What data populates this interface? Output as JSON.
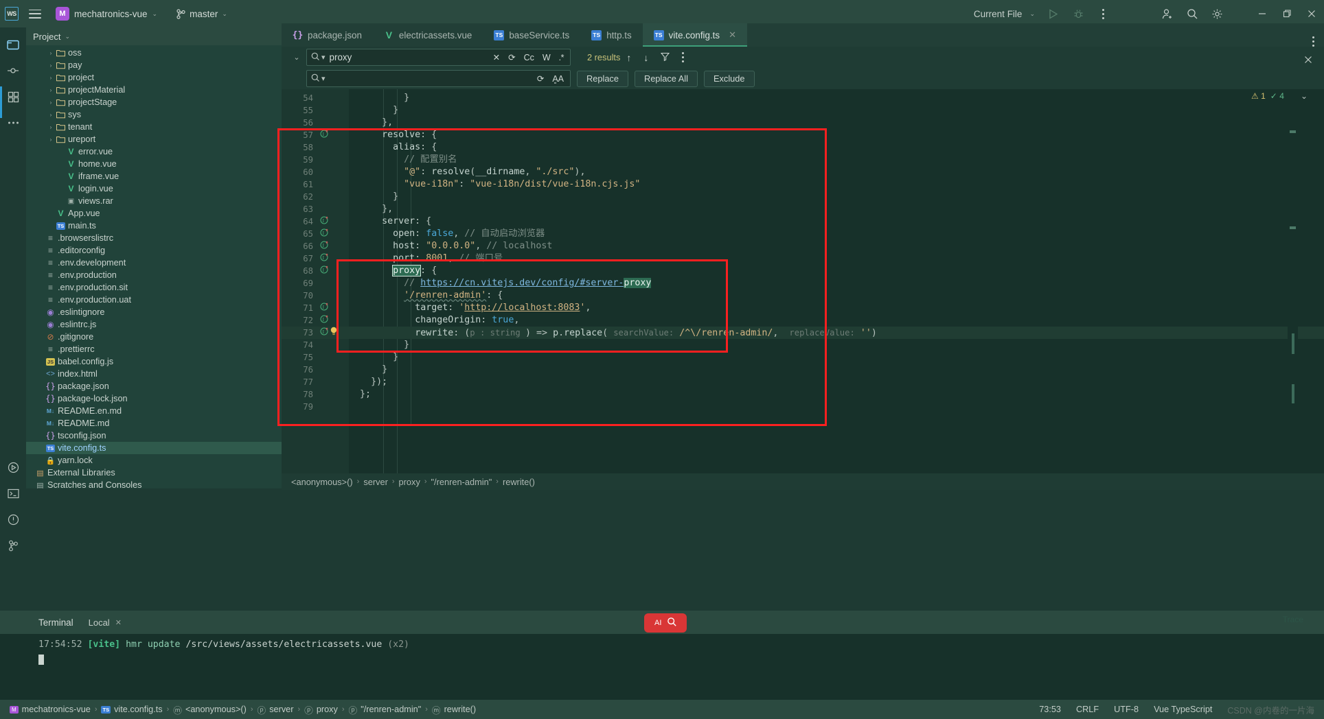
{
  "topbar": {
    "logo": "WS",
    "menu_icon": "hamburger-icon",
    "project_badge": "M",
    "project_name": "mechatronics-vue",
    "branch": "master",
    "run_config": "Current File",
    "icons": [
      "run-icon",
      "debug-icon",
      "more-vertical-icon",
      "add-user-icon",
      "search-icon",
      "settings-icon",
      "minimize-icon",
      "maximize-icon",
      "close-icon"
    ]
  },
  "project_pane": {
    "title": "Project",
    "tree": [
      {
        "indent": 2,
        "arrow": "›",
        "icon": "folder",
        "label": "oss"
      },
      {
        "indent": 2,
        "arrow": "›",
        "icon": "folder",
        "label": "pay"
      },
      {
        "indent": 2,
        "arrow": "›",
        "icon": "folder",
        "label": "project"
      },
      {
        "indent": 2,
        "arrow": "›",
        "icon": "folder",
        "label": "projectMaterial"
      },
      {
        "indent": 2,
        "arrow": "›",
        "icon": "folder",
        "label": "projectStage"
      },
      {
        "indent": 2,
        "arrow": "›",
        "icon": "folder",
        "label": "sys"
      },
      {
        "indent": 2,
        "arrow": "›",
        "icon": "folder",
        "label": "tenant"
      },
      {
        "indent": 2,
        "arrow": "›",
        "icon": "folder",
        "label": "ureport"
      },
      {
        "indent": 3,
        "arrow": "",
        "icon": "vue",
        "label": "error.vue"
      },
      {
        "indent": 3,
        "arrow": "",
        "icon": "vue",
        "label": "home.vue"
      },
      {
        "indent": 3,
        "arrow": "",
        "icon": "vue",
        "label": "iframe.vue"
      },
      {
        "indent": 3,
        "arrow": "",
        "icon": "vue",
        "label": "login.vue"
      },
      {
        "indent": 3,
        "arrow": "",
        "icon": "rar",
        "label": "views.rar"
      },
      {
        "indent": 2,
        "arrow": "",
        "icon": "vue",
        "label": "App.vue"
      },
      {
        "indent": 2,
        "arrow": "",
        "icon": "ts",
        "label": "main.ts"
      },
      {
        "indent": 1,
        "arrow": "",
        "icon": "cfg",
        "label": ".browserslistrc"
      },
      {
        "indent": 1,
        "arrow": "",
        "icon": "cfg",
        "label": ".editorconfig"
      },
      {
        "indent": 1,
        "arrow": "",
        "icon": "cfg",
        "label": ".env.development"
      },
      {
        "indent": 1,
        "arrow": "",
        "icon": "cfg",
        "label": ".env.production"
      },
      {
        "indent": 1,
        "arrow": "",
        "icon": "cfg",
        "label": ".env.production.sit"
      },
      {
        "indent": 1,
        "arrow": "",
        "icon": "cfg",
        "label": ".env.production.uat"
      },
      {
        "indent": 1,
        "arrow": "",
        "icon": "eslint",
        "label": ".eslintignore"
      },
      {
        "indent": 1,
        "arrow": "",
        "icon": "eslint",
        "label": ".eslintrc.js"
      },
      {
        "indent": 1,
        "arrow": "",
        "icon": "git",
        "label": ".gitignore"
      },
      {
        "indent": 1,
        "arrow": "",
        "icon": "cfg",
        "label": ".prettierrc"
      },
      {
        "indent": 1,
        "arrow": "",
        "icon": "js",
        "label": "babel.config.js"
      },
      {
        "indent": 1,
        "arrow": "",
        "icon": "html",
        "label": "index.html"
      },
      {
        "indent": 1,
        "arrow": "",
        "icon": "json",
        "label": "package.json"
      },
      {
        "indent": 1,
        "arrow": "",
        "icon": "json",
        "label": "package-lock.json"
      },
      {
        "indent": 1,
        "arrow": "",
        "icon": "md",
        "label": "README.en.md"
      },
      {
        "indent": 1,
        "arrow": "",
        "icon": "md",
        "label": "README.md"
      },
      {
        "indent": 1,
        "arrow": "",
        "icon": "json",
        "label": "tsconfig.json"
      },
      {
        "indent": 1,
        "arrow": "",
        "icon": "ts",
        "label": "vite.config.ts",
        "selected": true
      },
      {
        "indent": 1,
        "arrow": "",
        "icon": "lock",
        "label": "yarn.lock"
      },
      {
        "indent": 0,
        "arrow": "",
        "icon": "lib",
        "label": "External Libraries"
      },
      {
        "indent": 0,
        "arrow": "",
        "icon": "scratch",
        "label": "Scratches and Consoles"
      }
    ]
  },
  "tabs": [
    {
      "label": "package.json",
      "icon": "json-icon",
      "active": false
    },
    {
      "label": "electricassets.vue",
      "icon": "vue-icon",
      "active": false
    },
    {
      "label": "baseService.ts",
      "icon": "ts-icon",
      "active": false
    },
    {
      "label": "http.ts",
      "icon": "ts-icon",
      "active": false
    },
    {
      "label": "vite.config.ts",
      "icon": "ts-icon",
      "active": true,
      "closable": true
    }
  ],
  "find_panel": {
    "search_value": "proxy",
    "search_placeholder": "",
    "replace_value": "",
    "replace_placeholder": "",
    "results_text": "2 results",
    "toggles": [
      "Cc",
      "W",
      ".*"
    ],
    "buttons": [
      "Replace",
      "Replace All",
      "Exclude"
    ],
    "icons": [
      "collapse-chevron-icon",
      "magnifier-icon",
      "clear-x-icon",
      "regex-history-icon",
      "match-case-icon",
      "words-icon",
      "regex-icon",
      "prev-match-icon",
      "next-match-icon",
      "filter-icon",
      "more-options-icon",
      "preserve-case-icon",
      "close-find-icon"
    ]
  },
  "inspection": {
    "warn_count": "1",
    "ok_count": "4"
  },
  "editor": {
    "first_line": 54,
    "lines": [
      {
        "n": 54,
        "text": "          }"
      },
      {
        "n": 55,
        "text": "        }"
      },
      {
        "n": 56,
        "text": "      },"
      },
      {
        "n": 57,
        "text": "      resolve: {",
        "mark": true
      },
      {
        "n": 58,
        "text": "        alias: {"
      },
      {
        "n": 59,
        "text": "          // 配置别名"
      },
      {
        "n": 60,
        "text": "          \"@\": resolve(__dirname, \"./src\"),"
      },
      {
        "n": 61,
        "text": "          \"vue-i18n\": \"vue-i18n/dist/vue-i18n.cjs.js\""
      },
      {
        "n": 62,
        "text": "        }"
      },
      {
        "n": 63,
        "text": "      },"
      },
      {
        "n": 64,
        "text": "      server: {",
        "mark": true
      },
      {
        "n": 65,
        "text": "        open: false, // 自动启动浏览器",
        "mark": true
      },
      {
        "n": 66,
        "text": "        host: \"0.0.0.0\", // localhost",
        "mark": true
      },
      {
        "n": 67,
        "text": "        port: 8001, // 端口号",
        "mark": true
      },
      {
        "n": 68,
        "text": "        proxy: {",
        "mark": true
      },
      {
        "n": 69,
        "text": "          // https://cn.vitejs.dev/config/#server-proxy"
      },
      {
        "n": 70,
        "text": "          '/renren-admin': {"
      },
      {
        "n": 71,
        "text": "            target: 'http://localhost:8083',",
        "mark": true
      },
      {
        "n": 72,
        "text": "            changeOrigin: true,",
        "mark": true
      },
      {
        "n": 73,
        "text": "            rewrite: (p : string ) => p.replace( searchValue: /^\\/renren-admin/,  replaceValue: '')",
        "mark": true,
        "bulb": true,
        "current": true
      },
      {
        "n": 74,
        "text": "          }"
      },
      {
        "n": 75,
        "text": "        }"
      },
      {
        "n": 76,
        "text": "      }"
      },
      {
        "n": 77,
        "text": "    });"
      },
      {
        "n": 78,
        "text": "  };"
      },
      {
        "n": 79,
        "text": ""
      }
    ]
  },
  "breadcrumb": {
    "items": [
      "<anonymous>()",
      "server",
      "proxy",
      "\"/renren-admin\"",
      "rewrite()"
    ]
  },
  "terminal": {
    "title": "Terminal",
    "tab": "Local",
    "line_time": "17:54:52",
    "line_tag": "[vite]",
    "line_action": "hmr update",
    "line_path": "/src/views/assets/electricassets.vue",
    "line_suffix": "(x2)",
    "trace_label": "Trace"
  },
  "status_bar": {
    "crumbs": [
      "mechatronics-vue",
      "vite.config.ts",
      "<anonymous>()",
      "server",
      "proxy",
      "\"/renren-admin\"",
      "rewrite()"
    ],
    "caret": "73:53",
    "line_sep": "CRLF",
    "encoding": "UTF-8",
    "lang": "Vue TypeScript",
    "watermark": "CSDN @内卷的一片海"
  },
  "colors": {
    "accent_green": "#2b4a40",
    "editor_bg": "#17312a",
    "annotation_red": "#fb2020",
    "branch_purple": "#a855d8"
  }
}
